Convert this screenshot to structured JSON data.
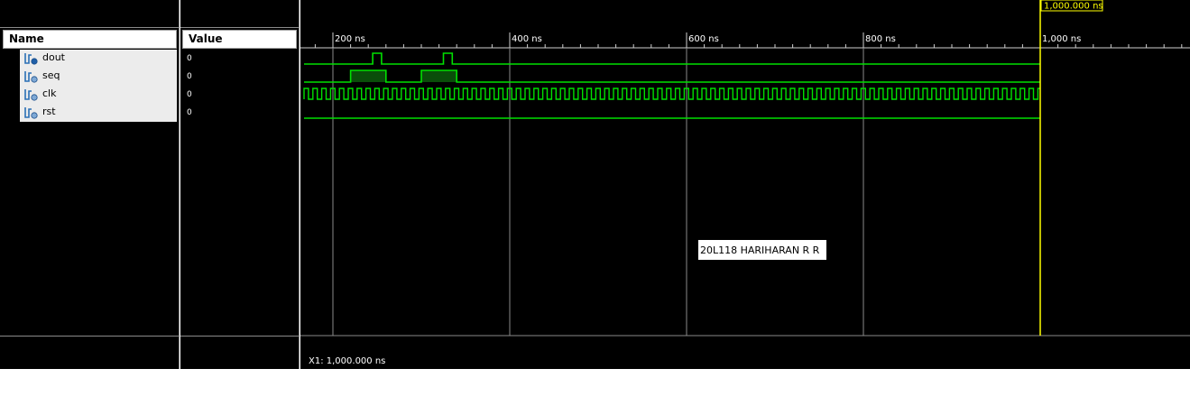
{
  "names_panel": {
    "header": "Name",
    "signals": [
      {
        "name": "dout",
        "icon": "signal-output-icon"
      },
      {
        "name": "seq",
        "icon": "signal-input-icon"
      },
      {
        "name": "clk",
        "icon": "signal-input-icon"
      },
      {
        "name": "rst",
        "icon": "signal-input-icon"
      }
    ]
  },
  "values_panel": {
    "header": "Value",
    "values": [
      "0",
      "0",
      "0",
      "0"
    ]
  },
  "timeline": {
    "cursor_label": "1,000.000 ns",
    "ticks": [
      {
        "time": 200,
        "label": "200 ns"
      },
      {
        "time": 400,
        "label": "400 ns"
      },
      {
        "time": 600,
        "label": "600 ns"
      },
      {
        "time": 800,
        "label": "800 ns"
      },
      {
        "time": 1000,
        "label": "1,000 ns"
      }
    ],
    "annotation": "20L118 HARIHARAN R R",
    "cursor_readout": "X1: 1,000.000 ns",
    "cursor_time": 1000
  },
  "waveforms": {
    "dout_pulses_ns": [
      [
        245,
        255
      ],
      [
        325,
        335
      ]
    ],
    "seq_high_ns": [
      [
        220,
        260
      ],
      [
        300,
        340
      ]
    ],
    "clk_period_ns": 10,
    "clk_start_ns": 165,
    "sim_end_ns": 1000
  },
  "colors": {
    "wave": "#00e000",
    "wave_fill": "#0a4d0a",
    "cursor": "#ffff00",
    "grid": "#8a8a8a"
  }
}
